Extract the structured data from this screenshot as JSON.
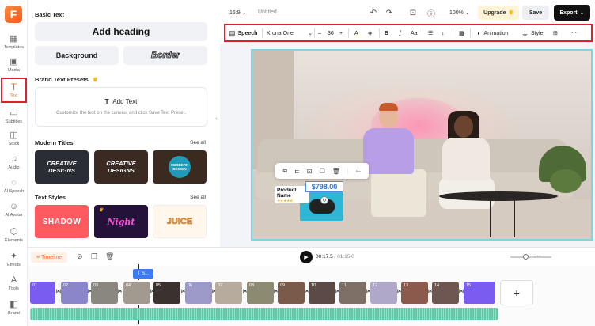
{
  "app": {
    "logo_letter": "F"
  },
  "rail": {
    "items": [
      {
        "label": "Templates",
        "icon": "templates-icon",
        "glyph": "▦"
      },
      {
        "label": "Media",
        "icon": "media-icon",
        "glyph": "▣"
      },
      {
        "label": "Text",
        "icon": "text-icon",
        "glyph": "T",
        "active": true
      },
      {
        "label": "Subtitles",
        "icon": "subtitles-icon",
        "glyph": "▭"
      },
      {
        "label": "Stock",
        "icon": "stock-icon",
        "glyph": "◫"
      },
      {
        "label": "Audio",
        "icon": "audio-icon",
        "glyph": "♫"
      },
      {
        "label": "AI Speech",
        "icon": "ai-speech-icon",
        "glyph": "◌"
      },
      {
        "label": "AI Avatar",
        "icon": "ai-avatar-icon",
        "glyph": "☺"
      },
      {
        "label": "Elements",
        "icon": "elements-icon",
        "glyph": "⬡"
      },
      {
        "label": "Effects",
        "icon": "effects-icon",
        "glyph": "✦"
      },
      {
        "label": "Tools",
        "icon": "tools-icon",
        "glyph": "A"
      },
      {
        "label": "Brand",
        "icon": "brand-icon",
        "glyph": "◧"
      }
    ]
  },
  "panel": {
    "basic_text_title": "Basic Text",
    "add_heading": "Add heading",
    "background": "Background",
    "border": "Border",
    "brand_presets_title": "Brand Text Presets",
    "add_text": "Add Text",
    "preset_hint": "Customize the text on the canvas, and click Save Text Preset.",
    "modern_titles": "Modern Titles",
    "see_all": "See all",
    "modern_thumbs": [
      "CREATIVE DESIGNS",
      "CREATIVE DESIGNS",
      "#MODERN DESIGN"
    ],
    "text_styles": "Text Styles",
    "style_thumbs": [
      "SHADOW",
      "Night",
      "JUICE"
    ]
  },
  "topbar": {
    "aspect": "16:9",
    "title": "Untitled",
    "zoom": "100%",
    "upgrade": "Upgrade",
    "save": "Save",
    "export": "Export"
  },
  "toolbar": {
    "speech": "Speech",
    "font": "Krona One",
    "size": "36",
    "case": "Aa",
    "animation": "Animation",
    "style": "Style"
  },
  "canvas": {
    "product_name": "Product Name",
    "price": "$798.00",
    "stars": "★★★★★"
  },
  "playback": {
    "timeline": "Timeline",
    "current": "00:17.5",
    "total": "/ 01:15.0"
  },
  "timeline": {
    "playhead_label": "T S...",
    "clips": [
      "01",
      "02",
      "03",
      "04",
      "05",
      "06",
      "07",
      "08",
      "09",
      "10",
      "11",
      "12",
      "13",
      "14",
      "15"
    ],
    "add": "+"
  }
}
